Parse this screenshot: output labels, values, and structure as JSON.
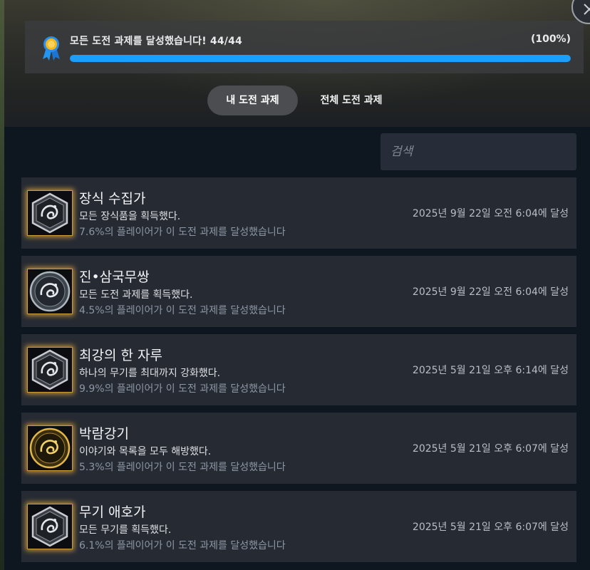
{
  "progress": {
    "title": "모든 도전 과제를 달성했습니다! 44/44",
    "percent_label": "(100%)",
    "fraction": 1.0,
    "bar_color": "#1a9fff"
  },
  "tabs": [
    {
      "label": "내 도전 과제",
      "active": true
    },
    {
      "label": "전체 도전 과제",
      "active": false
    }
  ],
  "search": {
    "placeholder": "검색",
    "value": ""
  },
  "close_icon": "close-icon",
  "achievements": [
    {
      "title": "장식 수집가",
      "description": "모든 장식품을 획득했다.",
      "rate": "7.6%의 플레이어가 이 도전 과제를 달성했습니다",
      "unlocked": "2025년 9월 22일 오전 6:04에 달성",
      "icon": "silver-hexagon-dragon-icon"
    },
    {
      "title": "진•삼국무쌍",
      "description": "모든 도전 과제를 획득했다.",
      "rate": "4.5%의 플레이어가 이 도전 과제를 달성했습니다",
      "unlocked": "2025년 9월 22일 오전 6:04에 달성",
      "icon": "silver-round-dragon-icon"
    },
    {
      "title": "최강의 한 자루",
      "description": "하나의 무기를 최대까지 강화했다.",
      "rate": "9.9%의 플레이어가 이 도전 과제를 달성했습니다",
      "unlocked": "2025년 5월 21일 오후 6:14에 달성",
      "icon": "silver-hexagon-dragon-icon"
    },
    {
      "title": "박람강기",
      "description": "이야기와 목록을 모두 해방했다.",
      "rate": "5.3%의 플레이어가 이 도전 과제를 달성했습니다",
      "unlocked": "2025년 5월 21일 오후 6:07에 달성",
      "icon": "gold-round-dragon-icon"
    },
    {
      "title": "무기 애호가",
      "description": "모든 무기를 획득했다.",
      "rate": "6.1%의 플레이어가 이 도전 과제를 달성했습니다",
      "unlocked": "2025년 5월 21일 오후 6:07에 달성",
      "icon": "silver-hexagon-dragon-icon"
    }
  ]
}
